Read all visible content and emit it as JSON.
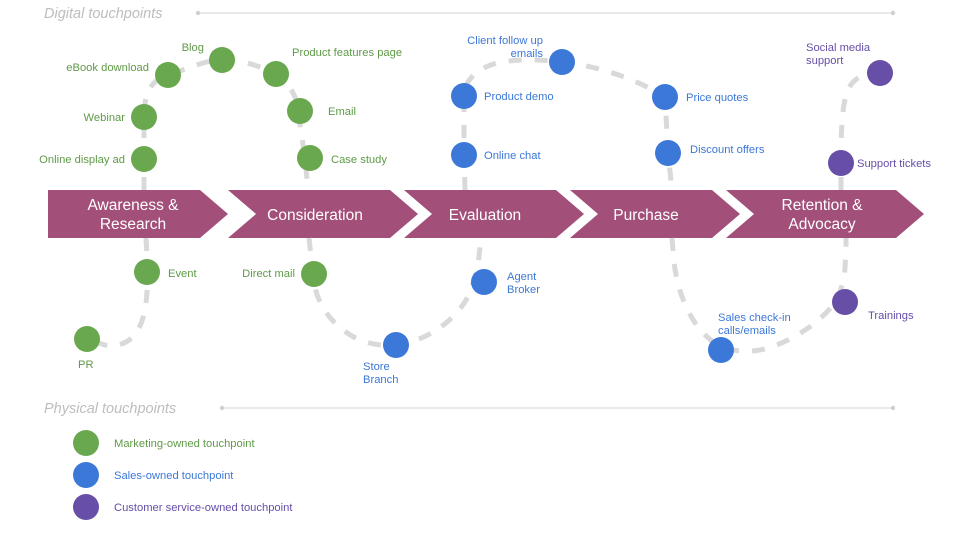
{
  "axes": {
    "digital": "Digital touchpoints",
    "physical": "Physical touchpoints"
  },
  "colors": {
    "marketing_green": "#6aa84f",
    "sales_blue": "#3c78d8",
    "service_purple": "#674ea7",
    "stage_band": "#a24f79",
    "connector_gray": "#d9d9d9",
    "axis_gray": "#bdbdbd"
  },
  "stages": [
    {
      "id": "awareness",
      "label": "Awareness &\nResearch",
      "line1": "Awareness &",
      "line2": "Research"
    },
    {
      "id": "consideration",
      "label": "Consideration",
      "line1": "Consideration",
      "line2": ""
    },
    {
      "id": "evaluation",
      "label": "Evaluation",
      "line1": "Evaluation",
      "line2": ""
    },
    {
      "id": "purchase",
      "label": "Purchase",
      "line1": "Purchase",
      "line2": ""
    },
    {
      "id": "retention",
      "label": "Retention &\nAdvocacy",
      "line1": "Retention &",
      "line2": "Advocacy"
    }
  ],
  "touchpoints": [
    {
      "id": "online-display-ad",
      "label": "Online display ad",
      "owner": "marketing",
      "region": "digital",
      "stage": "awareness"
    },
    {
      "id": "webinar",
      "label": "Webinar",
      "owner": "marketing",
      "region": "digital",
      "stage": "awareness"
    },
    {
      "id": "ebook-download",
      "label": "eBook download",
      "owner": "marketing",
      "region": "digital",
      "stage": "awareness"
    },
    {
      "id": "blog",
      "label": "Blog",
      "owner": "marketing",
      "region": "digital",
      "stage": "awareness"
    },
    {
      "id": "product-features-page",
      "label": "Product features page",
      "owner": "marketing",
      "region": "digital",
      "stage": "consideration"
    },
    {
      "id": "email",
      "label": "Email",
      "owner": "marketing",
      "region": "digital",
      "stage": "consideration"
    },
    {
      "id": "case-study",
      "label": "Case study",
      "owner": "marketing",
      "region": "digital",
      "stage": "consideration"
    },
    {
      "id": "online-chat",
      "label": "Online chat",
      "owner": "sales",
      "region": "digital",
      "stage": "evaluation"
    },
    {
      "id": "product-demo",
      "label": "Product demo",
      "owner": "sales",
      "region": "digital",
      "stage": "evaluation"
    },
    {
      "id": "client-follow-up",
      "label": "Client follow up\nemails",
      "line1": "Client follow up",
      "line2": "emails",
      "owner": "sales",
      "region": "digital",
      "stage": "evaluation"
    },
    {
      "id": "price-quotes",
      "label": "Price quotes",
      "owner": "sales",
      "region": "digital",
      "stage": "purchase"
    },
    {
      "id": "discount-offers",
      "label": "Discount offers",
      "owner": "sales",
      "region": "digital",
      "stage": "purchase"
    },
    {
      "id": "social-media-support",
      "label": "Social media\nsupport",
      "line1": "Social media",
      "line2": "support",
      "owner": "service",
      "region": "digital",
      "stage": "retention"
    },
    {
      "id": "support-tickets",
      "label": "Support tickets",
      "owner": "service",
      "region": "digital",
      "stage": "retention"
    },
    {
      "id": "pr",
      "label": "PR",
      "owner": "marketing",
      "region": "physical",
      "stage": "awareness"
    },
    {
      "id": "event",
      "label": "Event",
      "owner": "marketing",
      "region": "physical",
      "stage": "awareness"
    },
    {
      "id": "direct-mail",
      "label": "Direct mail",
      "owner": "marketing",
      "region": "physical",
      "stage": "consideration"
    },
    {
      "id": "store-branch",
      "label": "Store\nBranch",
      "line1": "Store",
      "line2": "Branch",
      "owner": "sales",
      "region": "physical",
      "stage": "consideration"
    },
    {
      "id": "agent-broker",
      "label": "Agent\nBroker",
      "line1": "Agent",
      "line2": "Broker",
      "owner": "sales",
      "region": "physical",
      "stage": "evaluation"
    },
    {
      "id": "sales-check-in",
      "label": "Sales check-in\ncalls/emails",
      "line1": "Sales check-in",
      "line2": "calls/emails",
      "owner": "sales",
      "region": "physical",
      "stage": "purchase"
    },
    {
      "id": "trainings",
      "label": "Trainings",
      "owner": "service",
      "region": "physical",
      "stage": "retention"
    }
  ],
  "legend": [
    {
      "id": "marketing",
      "label": "Marketing-owned touchpoint",
      "color": "#6aa84f"
    },
    {
      "id": "sales",
      "label": "Sales-owned touchpoint",
      "color": "#3c78d8"
    },
    {
      "id": "service",
      "label": "Customer service-owned touchpoint",
      "color": "#674ea7"
    }
  ]
}
